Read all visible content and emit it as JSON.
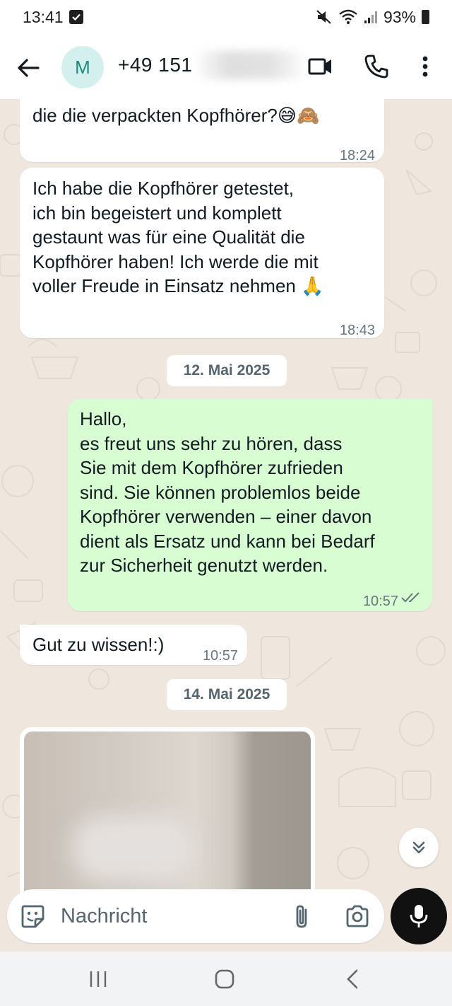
{
  "status_bar": {
    "time": "13:41",
    "battery": "93%"
  },
  "header": {
    "avatar_letter": "M",
    "contact_name": "+49 151"
  },
  "messages": [
    {
      "direction": "in",
      "text": "die die verpackten Kopfhörer?😅🙈",
      "time": "18:24"
    },
    {
      "direction": "in",
      "text": "Ich habe die Kopfhörer getestet,\nich bin begeistert und komplett\ngestaunt was für eine Qualität die\nKopfhörer haben! Ich werde die mit\nvoller Freude in Einsatz nehmen 🙏",
      "time": "18:43"
    },
    {
      "direction": "out",
      "text": "Hallo,\nes freut uns sehr zu hören, dass\nSie mit dem Kopfhörer zufrieden\nsind. Sie können problemlos beide\nKopfhörer verwenden – einer davon\ndient als Ersatz und kann bei Bedarf\nzur Sicherheit genutzt werden.",
      "time": "10:57"
    },
    {
      "direction": "in",
      "text": "Gut zu wissen!:)",
      "time": "10:57"
    }
  ],
  "date_separators": [
    "12. Mai 2025",
    "14. Mai 2025"
  ],
  "composer": {
    "placeholder": "Nachricht"
  },
  "colors": {
    "chat_background": "#efe7de",
    "incoming_bubble": "#ffffff",
    "outgoing_bubble": "#d9fdd3",
    "read_ticks": "#667781",
    "mic_button": "#111111"
  }
}
